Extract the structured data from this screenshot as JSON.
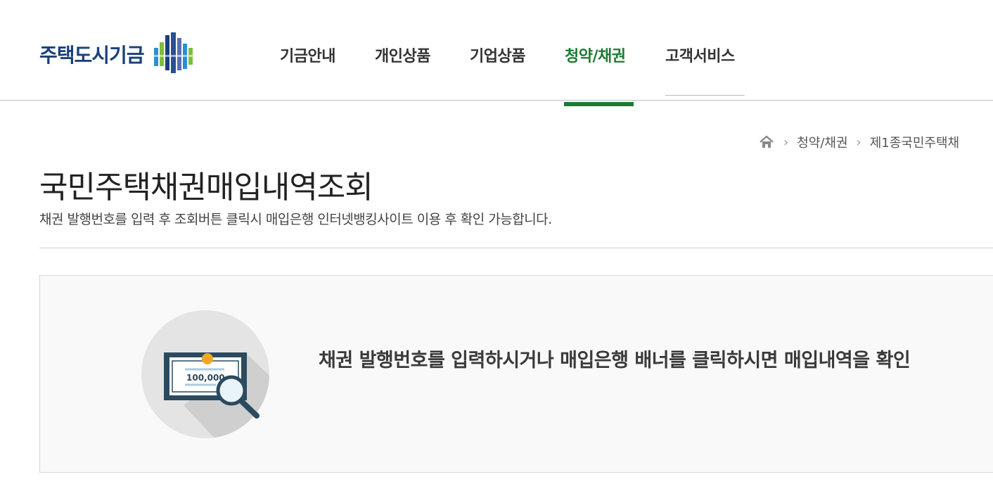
{
  "brand": {
    "name": "주택도시기금",
    "colors": {
      "primary_blue": "#1b3f7a",
      "accent_green": "#1d7a32"
    }
  },
  "nav": {
    "items": [
      {
        "label": "기금안내",
        "active": false
      },
      {
        "label": "개인상품",
        "active": false
      },
      {
        "label": "기업상품",
        "active": false
      },
      {
        "label": "청약/채권",
        "active": true
      },
      {
        "label": "고객서비스",
        "active": false
      }
    ]
  },
  "breadcrumb": {
    "home_icon": "home-icon",
    "items": [
      "청약/채권",
      "제1종국민주택채"
    ]
  },
  "page": {
    "title": "국민주택채권매입내역조회",
    "description": "채권 발행번호를 입력 후 조회버튼 클릭시 매입은행 인터넷뱅킹사이트 이용 후 확인 가능합니다."
  },
  "info_box": {
    "message": "채권 발행번호를 입력하시거나 매입은행 배너를 클릭하시면 매입내역을 확인",
    "illustration": "bond-search-illustration",
    "bond_amount": "100,000"
  }
}
